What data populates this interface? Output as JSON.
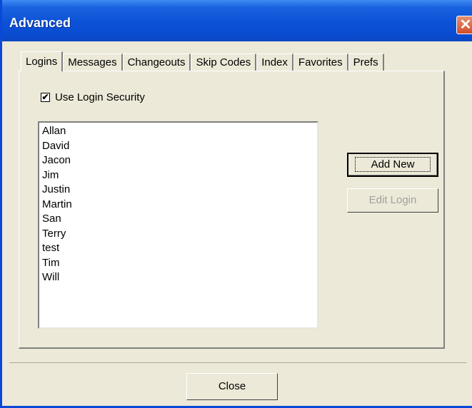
{
  "window": {
    "title": "Advanced",
    "close_glyph": "✕"
  },
  "tabs": [
    {
      "label": "Logins",
      "active": true
    },
    {
      "label": "Messages",
      "active": false
    },
    {
      "label": "Changeouts",
      "active": false
    },
    {
      "label": "Skip Codes",
      "active": false
    },
    {
      "label": "Index",
      "active": false
    },
    {
      "label": "Favorites",
      "active": false
    },
    {
      "label": "Prefs",
      "active": false
    }
  ],
  "logins_tab": {
    "use_login_security": {
      "label": "Use Login Security",
      "checked": true,
      "check_glyph": "✔"
    },
    "logins_list": [
      "Allan",
      "David",
      "Jacon",
      "Jim",
      "Justin",
      "Martin",
      "San",
      "Terry",
      "test",
      "Tim",
      "Will"
    ],
    "add_new_label": "Add New",
    "edit_login_label": "Edit Login"
  },
  "footer": {
    "close_label": "Close"
  },
  "colors": {
    "titlebar": "#0a52dc",
    "face": "#ece9d8",
    "close_button": "#d44d2a"
  }
}
